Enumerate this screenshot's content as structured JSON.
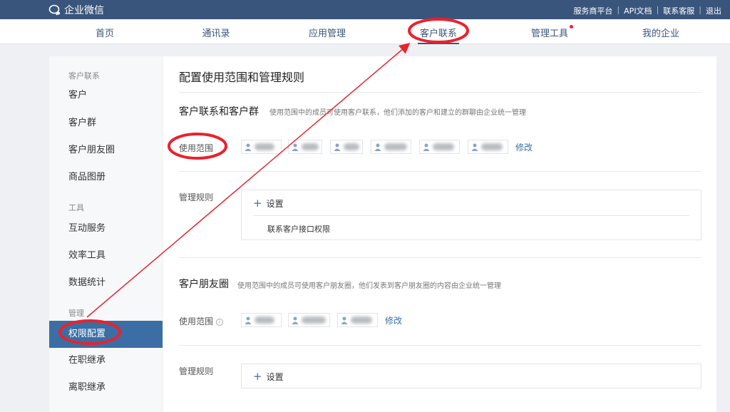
{
  "topbar": {
    "logo_text": "企业微信",
    "links": [
      "服务商平台",
      "API文档",
      "联系客服",
      "退出"
    ]
  },
  "nav": {
    "items": [
      {
        "label": "首页"
      },
      {
        "label": "通讯录"
      },
      {
        "label": "应用管理"
      },
      {
        "label": "客户联系",
        "active": true
      },
      {
        "label": "管理工具",
        "dot": true
      },
      {
        "label": "我的企业"
      }
    ]
  },
  "sidebar": {
    "groups": {
      "customer": "客户联系",
      "tools": "工具",
      "manage": "管理"
    },
    "items": [
      {
        "label": "客户"
      },
      {
        "label": "客户群"
      },
      {
        "label": "客户朋友圈"
      },
      {
        "label": "商品图册"
      },
      {
        "label": "互动服务"
      },
      {
        "label": "效率工具"
      },
      {
        "label": "数据统计"
      },
      {
        "label": "权限配置",
        "active": true
      },
      {
        "label": "在职继承"
      },
      {
        "label": "离职继承"
      }
    ]
  },
  "main": {
    "title": "配置使用范围和管理规则",
    "section1": {
      "title": "客户联系和客户群",
      "desc": "使用范围中的成员可使用客户联系，他们添加的客户和建立的群聊由企业统一管理",
      "scope_label": "使用范围",
      "edit": "修改",
      "rules_label": "管理规则",
      "add_label": "设置",
      "rule_item": "联系客户接口权限"
    },
    "section2": {
      "title": "客户朋友圈",
      "desc": "使用范围中的成员可使用客户朋友圈，他们发表到客户朋友圈的内容由企业统一管理",
      "scope_label": "使用范围",
      "info_icon": "i",
      "edit": "修改",
      "rules_label": "管理规则",
      "add_label": "设置"
    }
  },
  "colors": {
    "topbar": "#3a557c",
    "accent": "#3a6ea5",
    "annotation": "#e8232e"
  }
}
